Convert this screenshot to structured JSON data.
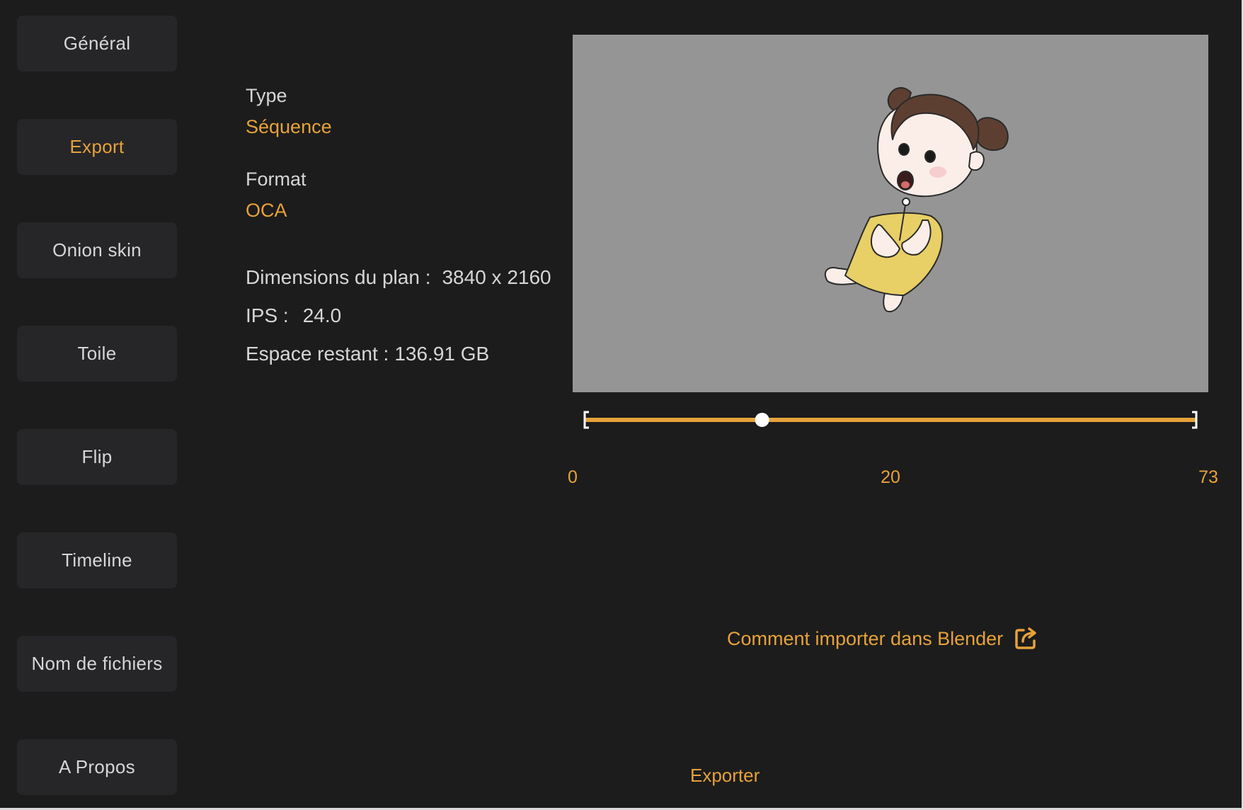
{
  "sidebar": {
    "items": [
      {
        "label": "Général"
      },
      {
        "label": "Export"
      },
      {
        "label": "Onion skin"
      },
      {
        "label": "Toile"
      },
      {
        "label": "Flip"
      },
      {
        "label": "Timeline"
      },
      {
        "label": "Nom de fichiers"
      },
      {
        "label": "A Propos"
      }
    ],
    "active": "Export"
  },
  "info": {
    "type_label": "Type",
    "type_value": "Séquence",
    "format_label": "Format",
    "format_value": "OCA",
    "dimensions_label": "Dimensions du plan :",
    "dimensions_value": "3840 x 2160",
    "fps_label": "IPS :",
    "fps_value": "24.0",
    "space_label": "Espace restant :",
    "space_value": "136.91 GB"
  },
  "preview": {
    "background_color": "#959595",
    "image": "cartoon-girl-illustration"
  },
  "timeline": {
    "min_label": "0",
    "mid_label": "20",
    "max_label": "73",
    "current_fraction": 0.29,
    "accent_color": "#e6a23a"
  },
  "links": {
    "blender_help": "Comment importer dans Blender",
    "blender_help_icon": "external-link-icon"
  },
  "actions": {
    "export_label": "Exporter"
  },
  "colors": {
    "background": "#1c1c1c",
    "button_bg": "#262629",
    "accent": "#e6a23a",
    "text": "#d6d6d6"
  }
}
